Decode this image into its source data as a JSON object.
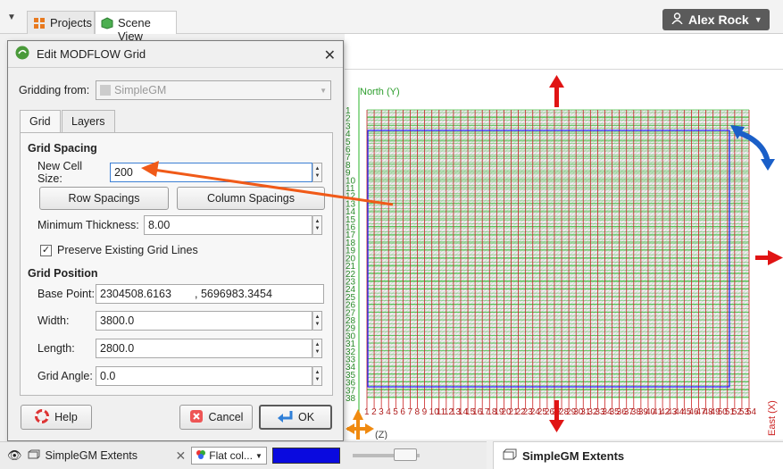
{
  "tabs": [
    {
      "label": "Projects"
    },
    {
      "label": "Scene View"
    }
  ],
  "user": {
    "name": "Alex Rock"
  },
  "scene": {
    "axis_north": "North (Y)",
    "axis_east": "East (X)",
    "axis_z": "(Z)",
    "row_labels": [
      "1",
      "2",
      "3",
      "4",
      "5",
      "6",
      "7",
      "8",
      "9",
      "10",
      "11",
      "12",
      "13",
      "14",
      "15",
      "16",
      "17",
      "18",
      "19",
      "20",
      "21",
      "22",
      "23",
      "24",
      "25",
      "26",
      "27",
      "28",
      "29",
      "30",
      "31",
      "32",
      "33",
      "34",
      "35",
      "36",
      "37",
      "38"
    ],
    "col_labels": [
      "1",
      "2",
      "3",
      "4",
      "5",
      "6",
      "7",
      "8",
      "9",
      "10",
      "11",
      "12",
      "13",
      "14",
      "15",
      "16",
      "17",
      "18",
      "19",
      "20",
      "21",
      "22",
      "23",
      "24",
      "25",
      "26",
      "27",
      "28",
      "29",
      "30",
      "31",
      "32",
      "33",
      "34",
      "35",
      "36",
      "37",
      "38",
      "39",
      "40",
      "41",
      "42",
      "43",
      "44",
      "45",
      "46",
      "47",
      "48",
      "49",
      "50",
      "51",
      "52",
      "53",
      "54"
    ],
    "colors": {
      "row_lines": "#3fbf3f",
      "col_lines": "#cc2222",
      "boundary": "#1a1aff",
      "arrow": "#e01414",
      "rotate": "#1a5fc8",
      "move": "#f08a10"
    }
  },
  "dialog": {
    "title": "Edit MODFLOW Grid",
    "close": "✕",
    "gridding_from_label": "Gridding from:",
    "gridding_from_value": "SimpleGM",
    "tab_grid": "Grid",
    "tab_layers": "Layers",
    "grid_spacing_heading": "Grid Spacing",
    "new_cell_size_label": "New Cell Size:",
    "new_cell_size_value": "200",
    "row_spacings_btn": "Row Spacings",
    "column_spacings_btn": "Column Spacings",
    "min_thickness_label": "Minimum Thickness:",
    "min_thickness_value": "8.00",
    "preserve_label": "Preserve Existing Grid Lines",
    "preserve_checked": "✓",
    "grid_position_heading": "Grid Position",
    "base_point_label": "Base Point:",
    "base_point_x": "2304508.6163",
    "base_point_y": ", 5696983.3454",
    "width_label": "Width:",
    "width_value": "3800.0",
    "length_label": "Length:",
    "length_value": "2800.0",
    "grid_angle_label": "Grid Angle:",
    "grid_angle_value": "0.0",
    "help_btn": "Help",
    "cancel_btn": "Cancel",
    "ok_btn": "OK"
  },
  "bottom": {
    "object_name": "SimpleGM Extents",
    "colour_mode": "Flat col...",
    "colour_value": "#0a0adf",
    "properties_title": "SimpleGM Extents"
  }
}
